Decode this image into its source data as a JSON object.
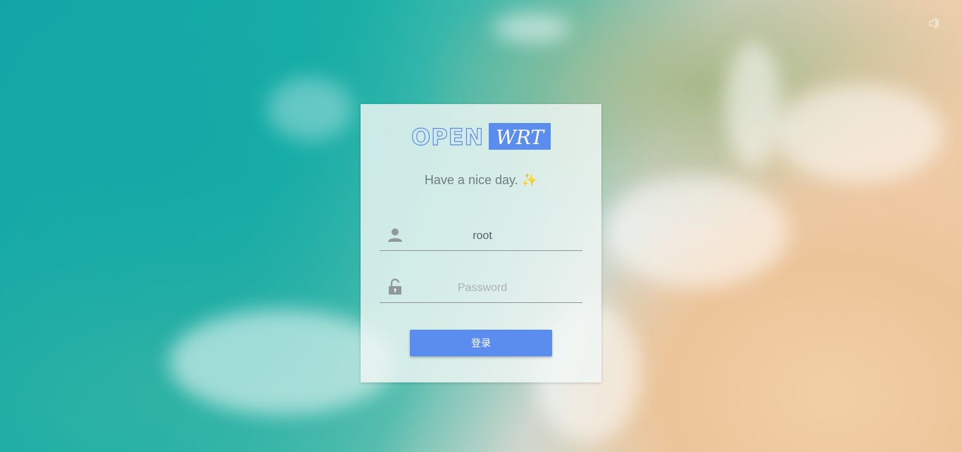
{
  "branding": {
    "logo_left": "OPEN",
    "logo_right": "WRT"
  },
  "greeting": {
    "text": "Have a nice day.",
    "emoji": "✨"
  },
  "login": {
    "username_value": "root",
    "password_placeholder": "Password",
    "submit_label": "登录"
  },
  "icons": {
    "user": "user-icon",
    "password": "unlock-icon",
    "audio": "mute-icon"
  },
  "colors": {
    "accent": "#5b8def",
    "logo_blue": "#5b8def"
  }
}
